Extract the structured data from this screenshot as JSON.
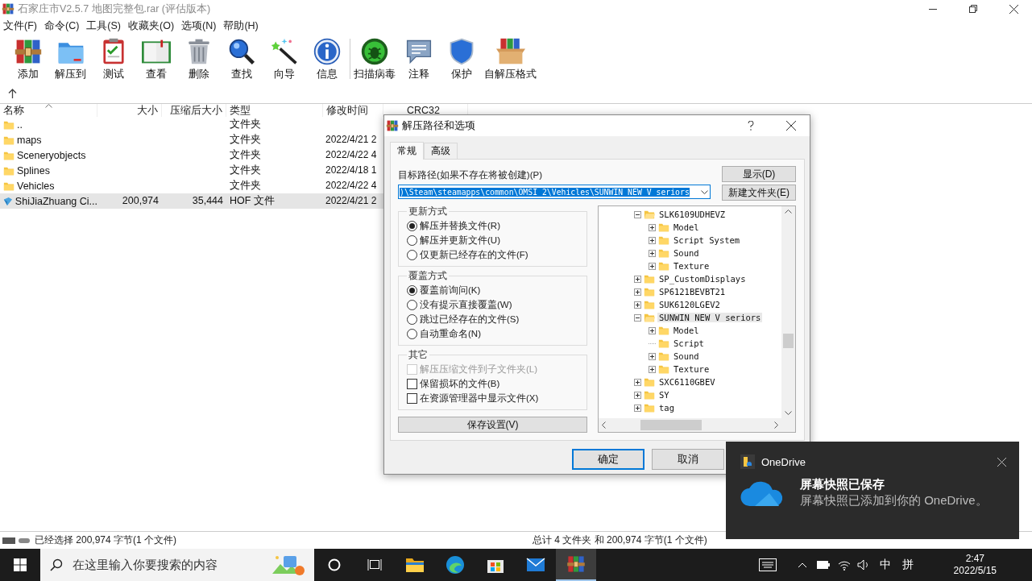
{
  "window": {
    "title": "石家庄市V2.5.7 地图完整包.rar (评估版本)"
  },
  "menu": [
    "文件(F)",
    "命令(C)",
    "工具(S)",
    "收藏夹(O)",
    "选项(N)",
    "帮助(H)"
  ],
  "toolbar": [
    {
      "label": "添加",
      "separator_before": false
    },
    {
      "label": "解压到",
      "separator_before": false
    },
    {
      "label": "测试",
      "separator_before": false
    },
    {
      "label": "查看",
      "separator_before": false
    },
    {
      "label": "删除",
      "separator_before": false
    },
    {
      "label": "查找",
      "separator_before": false
    },
    {
      "label": "向导",
      "separator_before": false
    },
    {
      "label": "信息",
      "separator_before": false
    },
    {
      "label": "扫描病毒",
      "separator_before": true
    },
    {
      "label": "注释",
      "separator_before": false
    },
    {
      "label": "保护",
      "separator_before": false
    },
    {
      "label": "自解压格式",
      "separator_before": false
    }
  ],
  "file_list": {
    "columns": [
      {
        "label": "名称",
        "sorted": true
      },
      {
        "label": "大小",
        "sorted": false
      },
      {
        "label": "压缩后大小",
        "sorted": false
      },
      {
        "label": "类型",
        "sorted": false
      },
      {
        "label": "修改时间",
        "sorted": false
      },
      {
        "label": "CRC32",
        "sorted": false
      }
    ],
    "rows": [
      {
        "kind": "folder",
        "name": "..",
        "type": "文件夹",
        "selected": false
      },
      {
        "kind": "folder",
        "name": "maps",
        "type": "文件夹",
        "modified": "2022/4/21 2",
        "selected": false
      },
      {
        "kind": "folder",
        "name": "Sceneryobjects",
        "type": "文件夹",
        "modified": "2022/4/22 4",
        "selected": false
      },
      {
        "kind": "folder",
        "name": "Splines",
        "type": "文件夹",
        "modified": "2022/4/18 1",
        "selected": false
      },
      {
        "kind": "folder",
        "name": "Vehicles",
        "type": "文件夹",
        "modified": "2022/4/22 4",
        "selected": false
      },
      {
        "kind": "file",
        "name": "ShiJiaZhuang Ci...",
        "size": "200,974",
        "packed": "35,444",
        "type": "HOF 文件",
        "modified": "2022/4/21 2",
        "selected": true
      }
    ]
  },
  "status_bar": {
    "left": "已经选择 200,974 字节(1 个文件)",
    "right": "总计 4 文件夹 和 200,974 字节(1 个文件)"
  },
  "dialog": {
    "title": "解压路径和选项",
    "tabs": [
      {
        "label": "常规",
        "selected": true
      },
      {
        "label": "高级",
        "selected": false
      }
    ],
    "path_label": "目标路径(如果不存在将被创建)(P)",
    "path_value": ")\\Steam\\steamapps\\common\\OMSI 2\\Vehicles\\SUNWIN NEW V seriors",
    "side_buttons": [
      "显示(D)",
      "新建文件夹(E)"
    ],
    "groups": [
      {
        "title": "更新方式",
        "kind": "radio",
        "options": [
          {
            "label": "解压并替换文件(R)",
            "selected": true
          },
          {
            "label": "解压并更新文件(U)",
            "selected": false
          },
          {
            "label": "仅更新已经存在的文件(F)",
            "selected": false
          }
        ]
      },
      {
        "title": "覆盖方式",
        "kind": "radio",
        "options": [
          {
            "label": "覆盖前询问(K)",
            "selected": true
          },
          {
            "label": "没有提示直接覆盖(W)",
            "selected": false
          },
          {
            "label": "跳过已经存在的文件(S)",
            "selected": false
          },
          {
            "label": "自动重命名(N)",
            "selected": false
          }
        ]
      },
      {
        "title": "其它",
        "kind": "checkbox",
        "options": [
          {
            "label": "解压压缩文件到子文件夹(L)",
            "checked": false,
            "disabled": true
          },
          {
            "label": "保留损坏的文件(B)",
            "checked": false,
            "disabled": false
          },
          {
            "label": "在资源管理器中显示文件(X)",
            "checked": false,
            "disabled": false
          }
        ]
      }
    ],
    "save_button": "保存设置(V)",
    "tree": [
      {
        "label": "SLK6109UDHEVZ",
        "expandable": true,
        "expanded": true,
        "selected": false,
        "children": [
          {
            "label": "Model",
            "expandable": true,
            "expanded": false,
            "selected": false
          },
          {
            "label": "Script System",
            "expandable": true,
            "expanded": false,
            "selected": false
          },
          {
            "label": "Sound",
            "expandable": true,
            "expanded": false,
            "selected": false
          },
          {
            "label": "Texture",
            "expandable": true,
            "expanded": false,
            "selected": false
          }
        ]
      },
      {
        "label": "SP_CustomDisplays",
        "expandable": true,
        "expanded": false,
        "selected": false
      },
      {
        "label": "SP6121BEVBT21",
        "expandable": true,
        "expanded": false,
        "selected": false
      },
      {
        "label": "SUK6120LGEV2",
        "expandable": true,
        "expanded": false,
        "selected": false
      },
      {
        "label": "SUNWIN NEW V seriors",
        "expandable": true,
        "expanded": true,
        "selected": true,
        "children": [
          {
            "label": "Model",
            "expandable": true,
            "expanded": false,
            "selected": false
          },
          {
            "label": "Script",
            "expandable": false,
            "expanded": false,
            "selected": false
          },
          {
            "label": "Sound",
            "expandable": true,
            "expanded": false,
            "selected": false
          },
          {
            "label": "Texture",
            "expandable": true,
            "expanded": false,
            "selected": false
          }
        ]
      },
      {
        "label": "SXC6110GBEV",
        "expandable": true,
        "expanded": false,
        "selected": false
      },
      {
        "label": "SY",
        "expandable": true,
        "expanded": false,
        "selected": false
      },
      {
        "label": "tag",
        "expandable": true,
        "expanded": false,
        "selected": false
      }
    ],
    "buttons": [
      {
        "label": "确定",
        "default": true
      },
      {
        "label": "取消",
        "default": false
      }
    ]
  },
  "toast": {
    "app": "OneDrive",
    "title": "屏幕快照已保存",
    "body": "屏幕快照已添加到你的 OneDrive。"
  },
  "taskbar": {
    "search_placeholder": "在这里输入你要搜索的内容",
    "apps": [
      {
        "active": false
      },
      {
        "active": false
      },
      {
        "active": false
      },
      {
        "active": false
      },
      {
        "active": true
      }
    ],
    "ime": "中",
    "ime_mode": "拼",
    "time": "2:47",
    "date": "2022/5/15"
  }
}
